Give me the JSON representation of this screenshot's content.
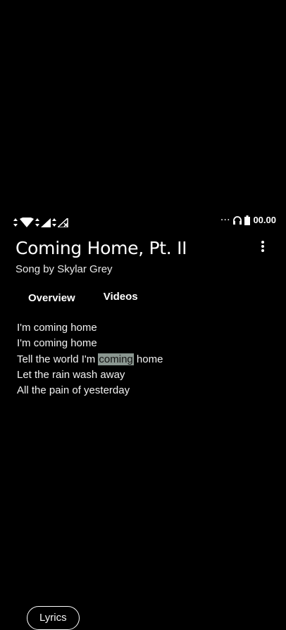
{
  "status_bar": {
    "icons_left": [
      "data-arrows-icon",
      "wifi-icon",
      "signal-icon",
      "signal-no-service-icon"
    ],
    "overflow": "···",
    "icons_right": [
      "headphones-icon",
      "battery-icon"
    ],
    "time": "00.00"
  },
  "song": {
    "title": "Coming Home, Pt. II",
    "subtitle": "Song by Skylar Grey"
  },
  "tabs": [
    {
      "label": "Overview"
    },
    {
      "label": "Lyrics",
      "selected": true
    },
    {
      "label": "Videos"
    }
  ],
  "lyrics": {
    "line1": "I'm coming home",
    "line2": "I'm coming home",
    "line3_before": "Tell the world I'm ",
    "line3_highlight": "coming",
    "line3_after": " home",
    "line4": "Let the rain wash away",
    "line5": "All the pain of yesterday"
  }
}
